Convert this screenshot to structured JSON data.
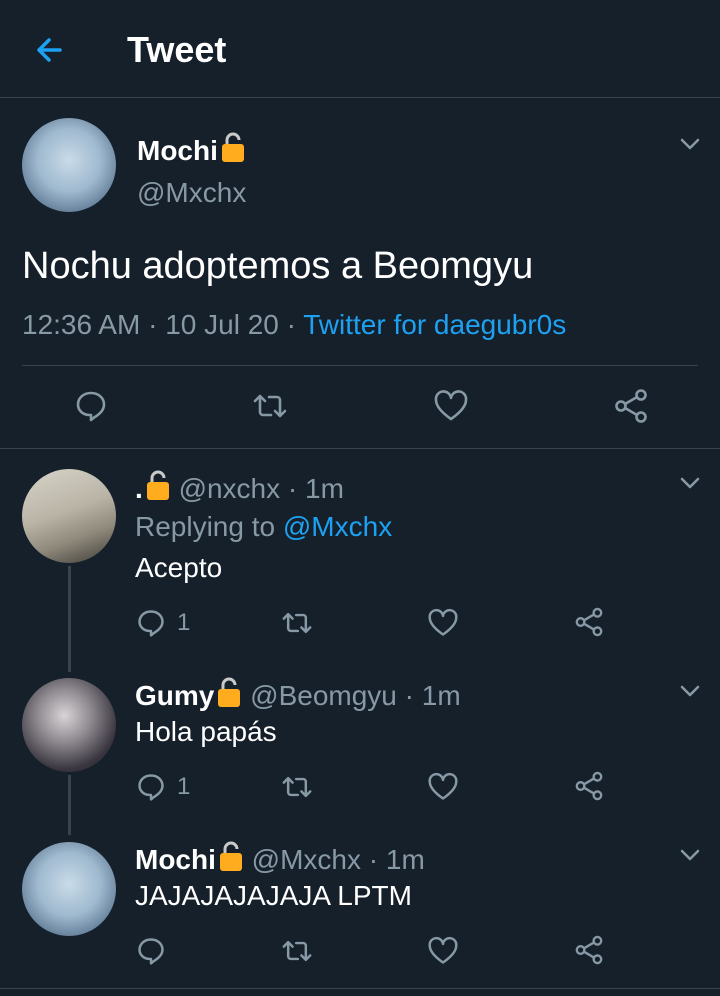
{
  "header": {
    "title": "Tweet"
  },
  "main_tweet": {
    "name": "Mochi",
    "handle": "@Mxchx",
    "text": "Nochu adoptemos a Beomgyu",
    "time": "12:36 AM",
    "sep1": "·",
    "date": "10 Jul 20",
    "sep2": "·",
    "source": "Twitter for daegubr0s"
  },
  "replies": [
    {
      "name": ".",
      "handle": "@nxchx",
      "sep": "·",
      "time": "1m",
      "replying_prefix": "Replying to",
      "replying_to": "@Mxchx",
      "text": "Acepto",
      "reply_count": "1"
    },
    {
      "name": "Gumy",
      "handle": "@Beomgyu",
      "sep": "·",
      "time": "1m",
      "text": "Hola papás",
      "reply_count": "1"
    },
    {
      "name": "Mochi",
      "handle": "@Mxchx",
      "sep": "·",
      "time": "1m",
      "text": "JAJAJAJAJAJA LPTM"
    }
  ],
  "colors": {
    "background": "#15202b",
    "accent": "#1da1f2",
    "muted": "#8899a6",
    "divider": "#38444d",
    "lock": "#ffad1f"
  },
  "icons": [
    "back-arrow-icon",
    "lock-icon",
    "chevron-down-icon",
    "reply-icon",
    "retweet-icon",
    "like-icon",
    "share-icon"
  ]
}
